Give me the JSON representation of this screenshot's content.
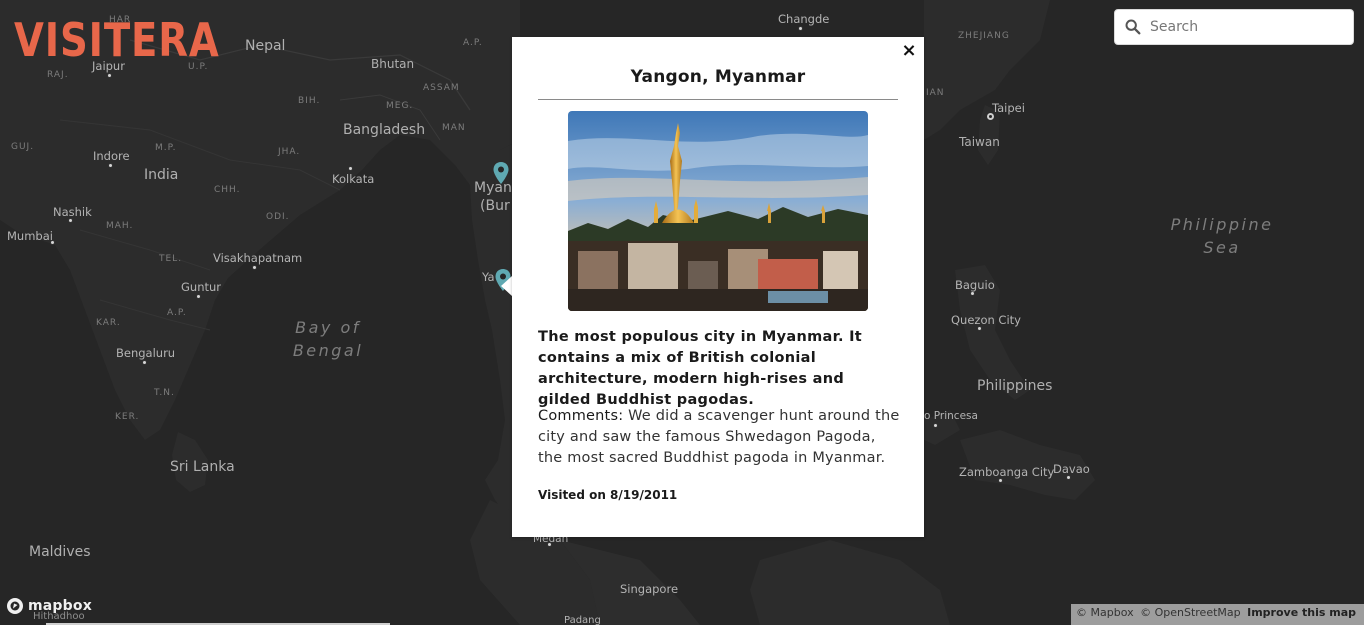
{
  "app": {
    "logo_text": "VISITERA"
  },
  "search": {
    "placeholder": "Search",
    "value": "",
    "icon": "search-icon"
  },
  "map_labels": {
    "countries": [
      "Nepal",
      "Bhutan",
      "Bangladesh",
      "India",
      "Myan",
      "(Bur",
      "Sri Lanka",
      "Maldives",
      "Taiwan",
      "Philippines"
    ],
    "cities": [
      "Changde",
      "Jaipur",
      "Kolkata",
      "Indore",
      "Nashik",
      "Mumbai",
      "Visakhapatnam",
      "Guntur",
      "Bengaluru",
      "Taipei",
      "Baguio",
      "Quezon City",
      "o Princesa",
      "Zamboanga City",
      "Davao",
      "Singapore",
      "Medan",
      "Hithadhoo",
      "Padang",
      "Ya"
    ],
    "states": [
      "HAR",
      "U.P.",
      "RAJ.",
      "GUJ.",
      "M.P.",
      "BIH.",
      "JHA.",
      "CHH.",
      "ODI.",
      "MAH.",
      "TEL.",
      "A.P.",
      "KAR.",
      "T.N.",
      "KER.",
      "A.P.",
      "ASSAM",
      "MEG.",
      "MAN",
      "ZHEJIANG",
      "IAN"
    ],
    "seas": [
      "Bay of Bengal",
      "Philippine Sea"
    ]
  },
  "popup": {
    "title": "Yangon, Myanmar",
    "description": "The most populous city in Myanmar. It contains a mix of British colonial architecture, modern high-rises and gilded Buddhist pagodas.",
    "comments_label": "Comments:",
    "comments_text": " We did a scavenger hunt around the city and saw the famous Shwedagon Pagoda, the most sacred Buddhist pagoda in Myanmar.",
    "visited": "Visited on 8/19/2011",
    "close_label": "×"
  },
  "attribution": {
    "mapbox": "© Mapbox",
    "osm": "© OpenStreetMap",
    "improve": "Improve this map",
    "logo_text": "mapbox"
  },
  "colors": {
    "accent": "#e8674a",
    "marker": "#5fa9b2",
    "map_bg": "#262626",
    "land": "#2b2b2b"
  }
}
